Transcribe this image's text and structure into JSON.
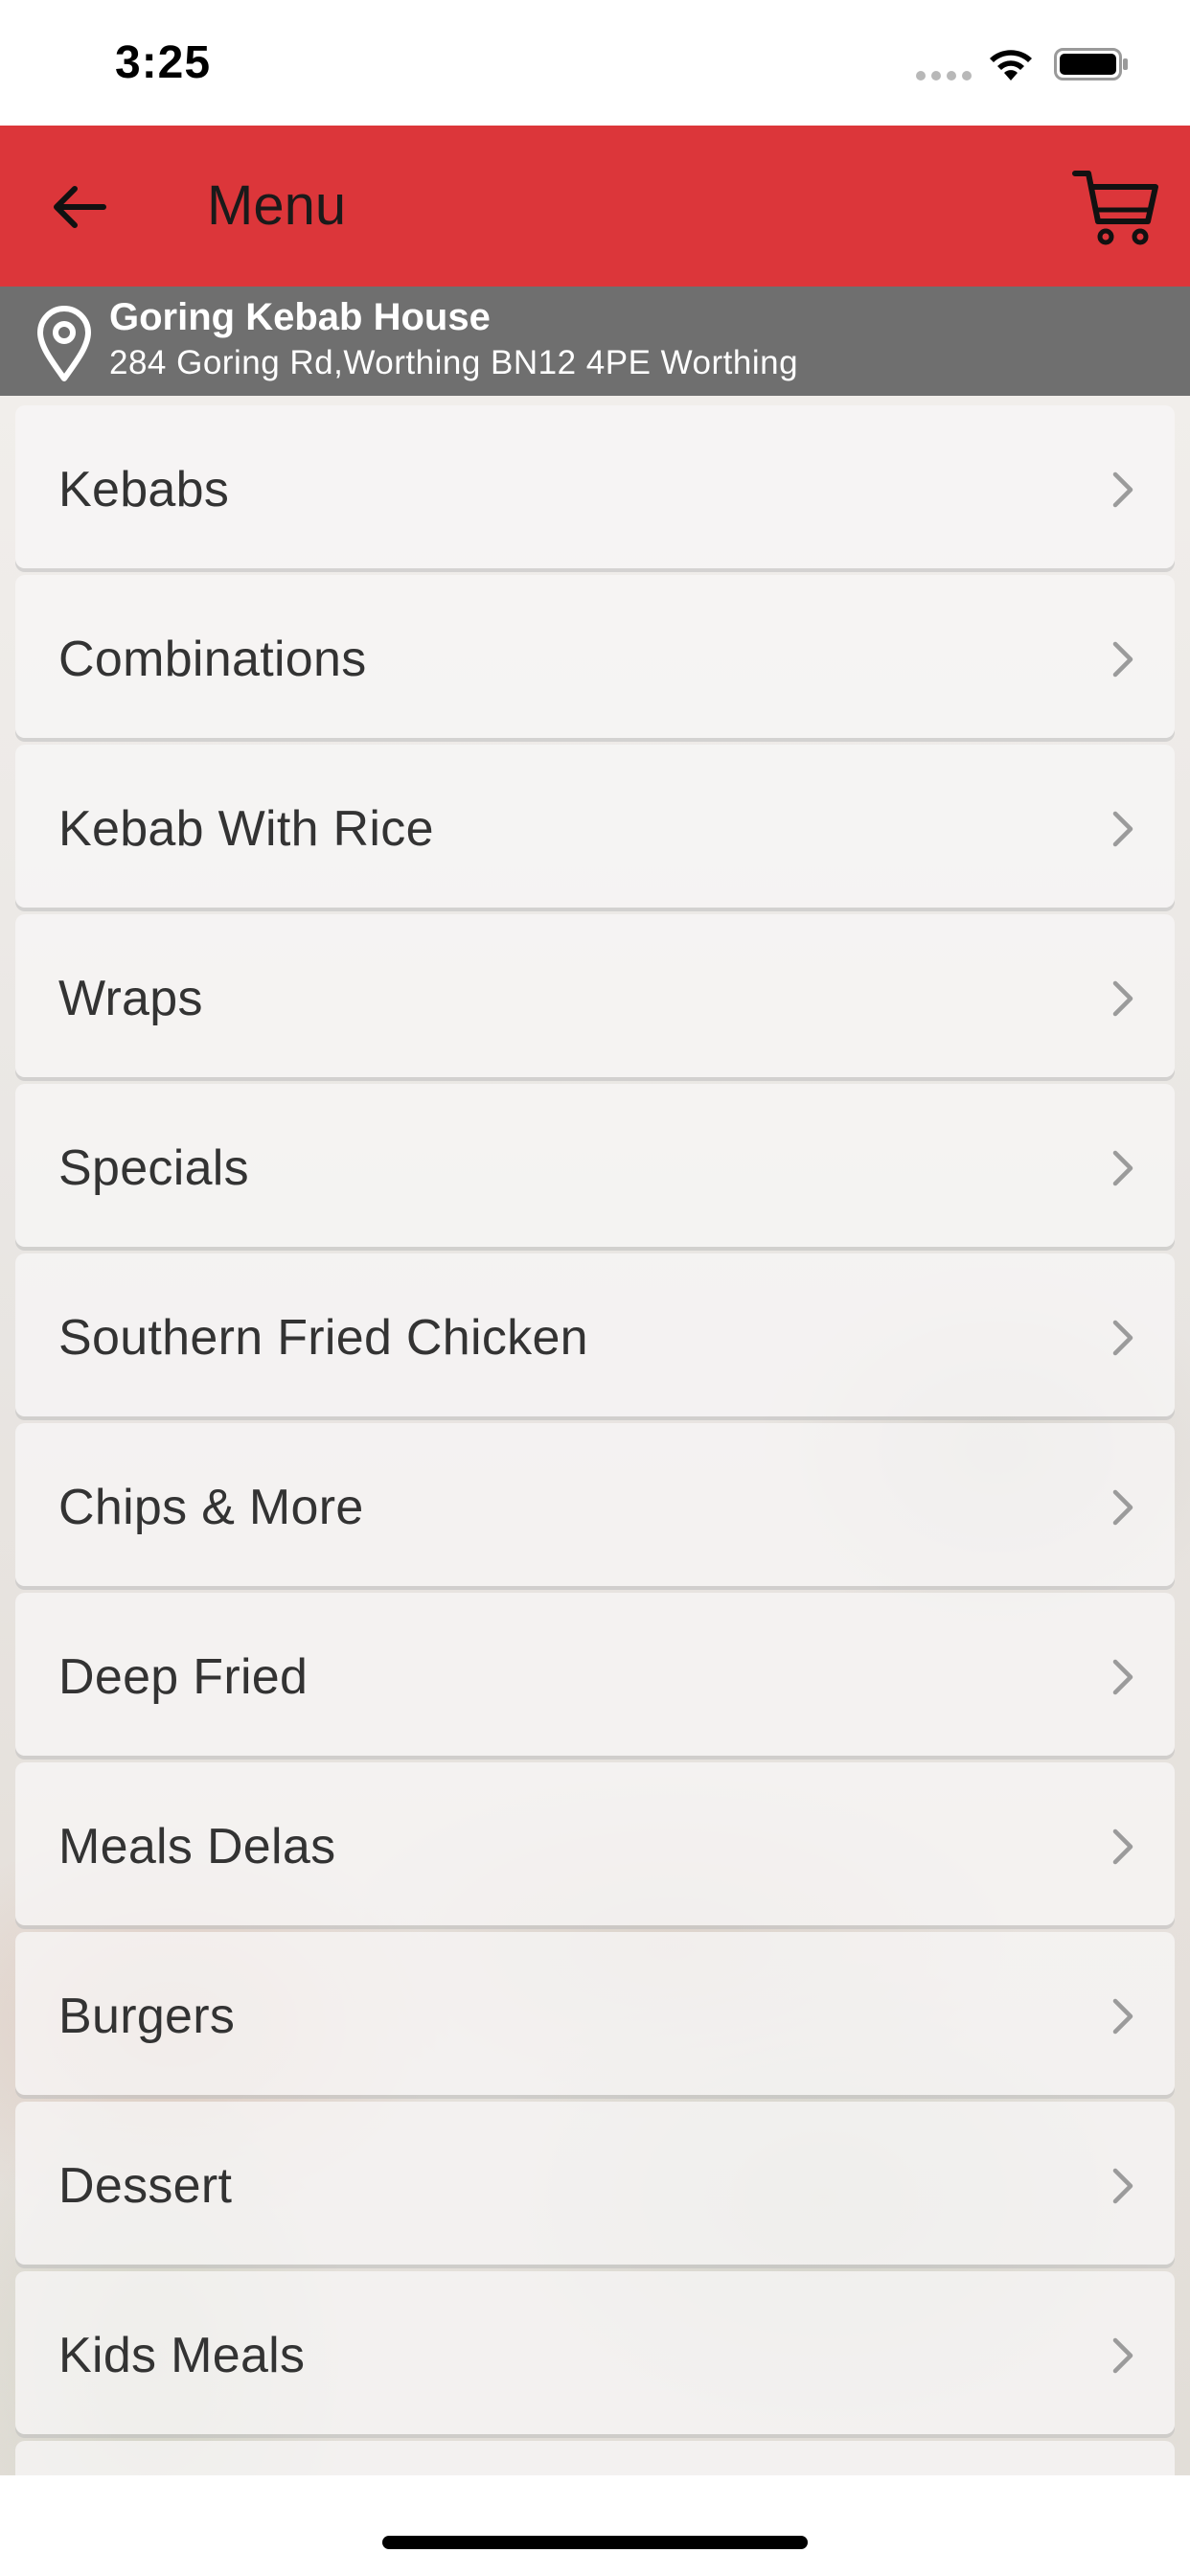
{
  "status_bar": {
    "time": "3:25"
  },
  "header": {
    "title": "Menu",
    "back_icon": "arrow-left-icon",
    "cart_icon": "cart-icon",
    "background_color": "#dc363a"
  },
  "location": {
    "name": "Goring Kebab House",
    "address": "284 Goring Rd,Worthing BN12 4PE Worthing",
    "icon": "location-pin-icon"
  },
  "menu": {
    "items": [
      {
        "label": "Kebabs"
      },
      {
        "label": "Combinations"
      },
      {
        "label": "Kebab With Rice"
      },
      {
        "label": "Wraps"
      },
      {
        "label": "Specials"
      },
      {
        "label": "Southern Fried Chicken"
      },
      {
        "label": "Chips & More"
      },
      {
        "label": "Deep Fried"
      },
      {
        "label": "Meals Delas"
      },
      {
        "label": "Burgers"
      },
      {
        "label": "Dessert"
      },
      {
        "label": "Kids Meals"
      },
      {
        "label": ""
      }
    ]
  }
}
